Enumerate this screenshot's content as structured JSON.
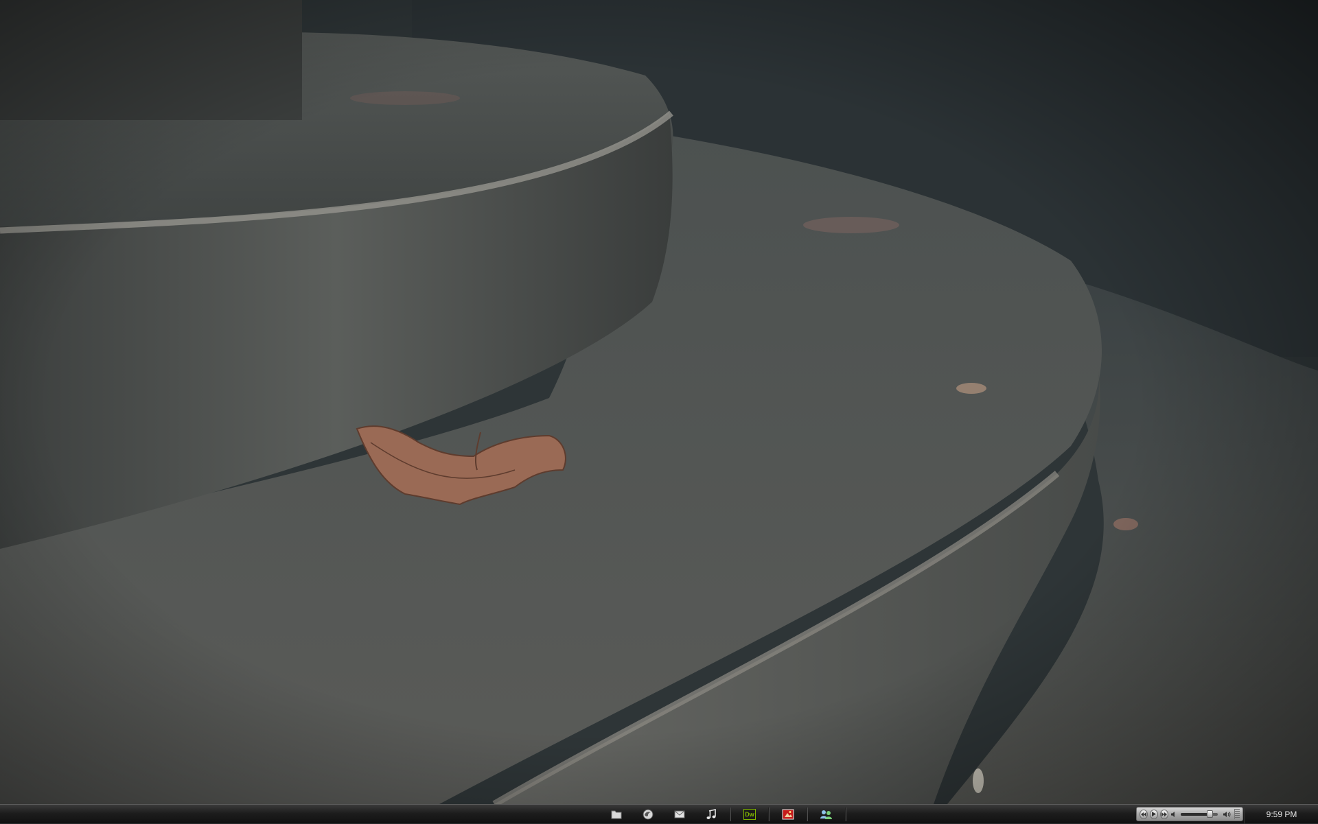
{
  "taskbar": {
    "dock_items": [
      {
        "name": "folder-icon",
        "active": false
      },
      {
        "name": "firefox-icon",
        "active": false
      },
      {
        "name": "mail-icon",
        "active": false
      },
      {
        "name": "music-note-icon",
        "active": false
      },
      {
        "name": "dreamweaver-icon",
        "label": "Dw",
        "active": true
      },
      {
        "name": "photo-app-icon",
        "active": true
      },
      {
        "name": "network-people-icon",
        "active": true
      }
    ],
    "media": {
      "volume_level": 0.78
    },
    "clock": "9:59 PM"
  },
  "colors": {
    "dreamweaver_green": "#7fb300",
    "photo_red": "#c51b1b",
    "wallpaper_leaf": "#9a6a55"
  }
}
